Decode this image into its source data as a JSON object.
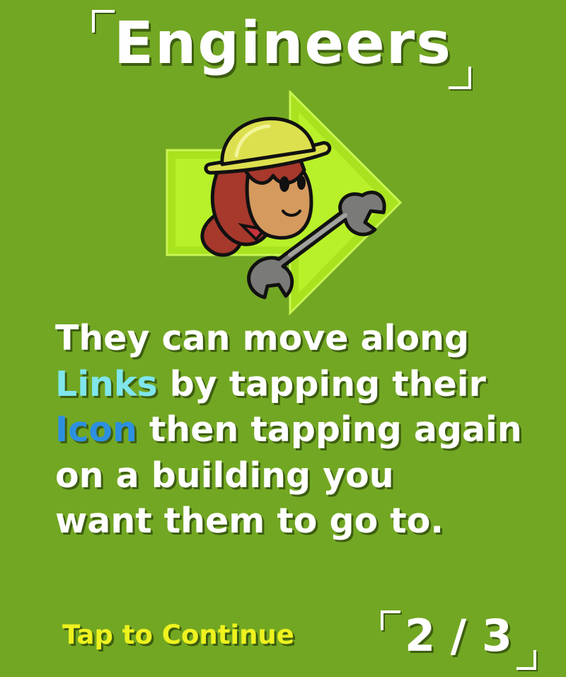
{
  "title": "Engineers",
  "body": {
    "line1": "They can move along",
    "line2_keyword": "Links",
    "line2_rest": " by tapping their",
    "line3_keyword": "Icon",
    "line3_rest": " then tapping again",
    "line4": "on a building you",
    "line5": "want them to go to."
  },
  "prompt": "Tap to Continue",
  "pager": {
    "text": "2 / 3",
    "current": 2,
    "total": 3
  },
  "colors": {
    "background": "#72a723",
    "keyword_links": "#7fe6ec",
    "keyword_icon": "#2d8fe0",
    "prompt": "#eef21e",
    "arrow": "#b8f02a"
  },
  "icons": {
    "engineer": "engineer-character-icon",
    "wrench": "wrench-icon",
    "arrow": "move-arrow-icon"
  }
}
